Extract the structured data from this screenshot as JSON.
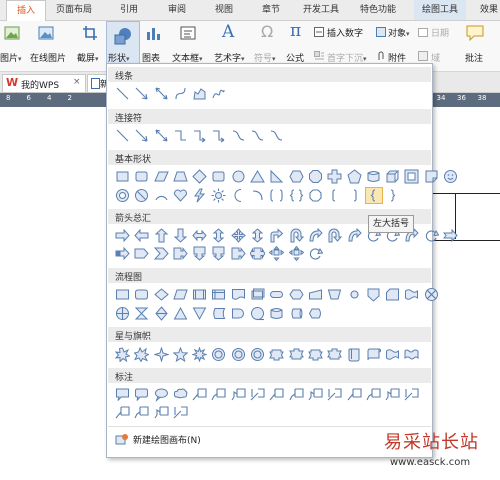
{
  "tabs": {
    "insert": "插入",
    "page_layout": "页面布局",
    "references": "引用",
    "review": "审阅",
    "view": "视图",
    "section": "章节",
    "developer": "开发工具",
    "special": "特色功能",
    "drawing_tools": "绘图工具",
    "effects": "效果"
  },
  "ribbon": {
    "picture": "图片",
    "online_picture": "在线图片",
    "screenshot": "截屏",
    "shapes": "形状",
    "chart": "图表",
    "textbox": "文本框",
    "wordart": "艺术字",
    "symbol": "符号",
    "formula": "公式",
    "insert_number": "插入数字",
    "object": "对象",
    "date": "日期",
    "dropcap": "首字下沉",
    "attachment": "附件",
    "field": "域",
    "comment": "批注",
    "dd_arrow": "▾",
    "omega": "Ω",
    "pi": "π",
    "wordart_glyph": "A"
  },
  "doctabs": {
    "wps_logo": "W",
    "my_wps": "我的WPS",
    "close": "×",
    "doc_partial": "新"
  },
  "ruler": {
    "ticks": [
      "8",
      "6",
      "4",
      "2",
      "",
      "2",
      "4",
      "6",
      "8",
      "10",
      "12",
      "14",
      "16",
      "18",
      "20",
      "22",
      "24",
      "26",
      "28",
      "30",
      "32",
      "34",
      "36",
      "38"
    ]
  },
  "menu": {
    "sections": {
      "lines": "线条",
      "connectors": "连接符",
      "basic": "基本形状",
      "arrows": "箭头总汇",
      "flowchart": "流程图",
      "stars": "星与旗帜",
      "callouts": "标注"
    },
    "new_canvas": "新建绘图画布(N)",
    "tooltip": "左大括号"
  },
  "watermark": {
    "text": "易采站长站",
    "url": "www.easck.com"
  },
  "colors": {
    "accent_orange": "#e2561e",
    "ruler": "#5c6b7d",
    "shape_stroke": "#5b7fae",
    "shape_fill": "#dfe8f4",
    "watermark_red": "#c0392b"
  }
}
